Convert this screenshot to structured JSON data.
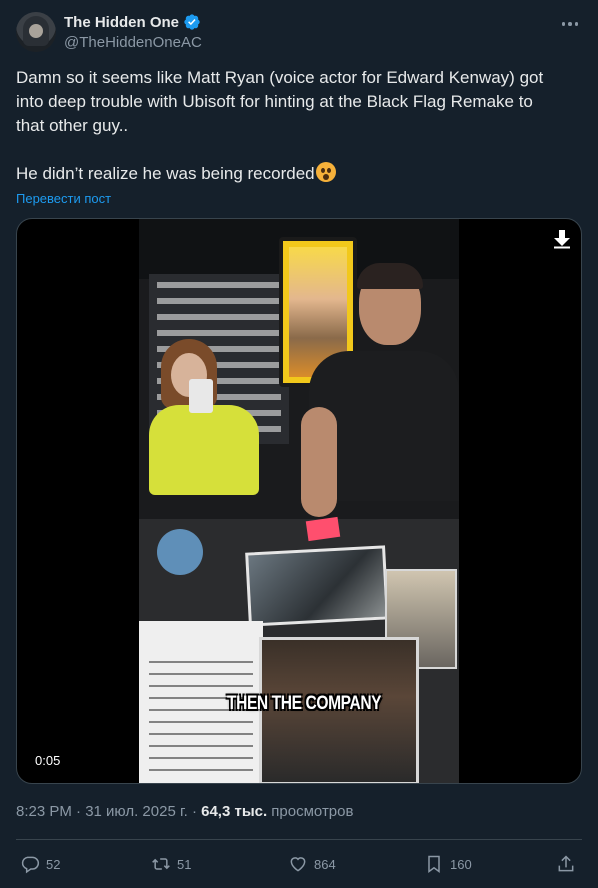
{
  "author": {
    "display_name": "The Hidden One",
    "handle": "@TheHiddenOneAC"
  },
  "post": {
    "text_line1": "Damn so it seems like Matt Ryan (voice actor for Edward Kenway) got into deep trouble with Ubisoft for hinting at the Black Flag Remake to that other guy..",
    "text_line2": "He didn’t realize he was being recorded",
    "emoji": "astonished-face-emoji",
    "translate_label": "Перевести пост"
  },
  "media": {
    "caption": "THEN THE COMPANY",
    "duration": "0:05",
    "download_icon": "download-arrow-icon"
  },
  "meta": {
    "timestamp": "8:23 PM · 31 июл. 2025 г. · ",
    "views_count": "64,3 тыс.",
    "views_label": " просмотров"
  },
  "actions": {
    "replies": "52",
    "reposts": "51",
    "likes": "864",
    "bookmarks": "160"
  },
  "colors": {
    "background": "#15202b",
    "link": "#1d9bf0",
    "verified": "#1d9bf0",
    "secondary_text": "#8b98a5"
  }
}
